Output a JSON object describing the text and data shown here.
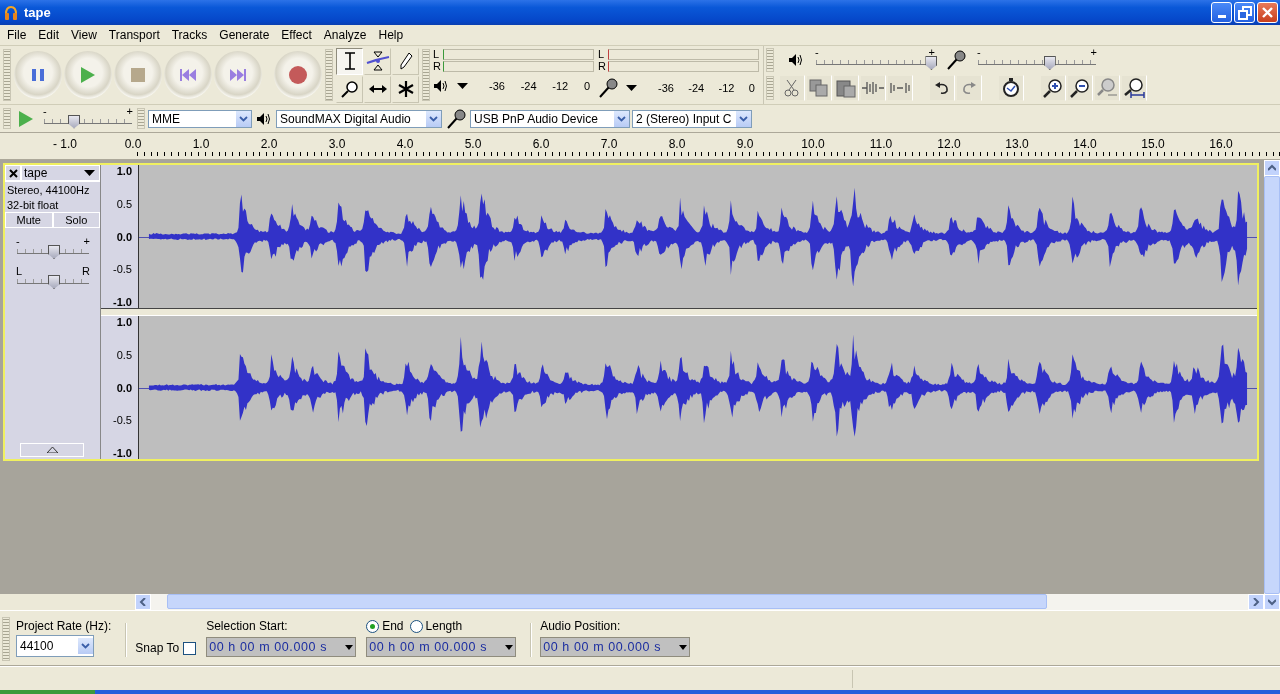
{
  "window": {
    "title": "tape"
  },
  "menu": [
    "File",
    "Edit",
    "View",
    "Transport",
    "Tracks",
    "Generate",
    "Effect",
    "Analyze",
    "Help"
  ],
  "transport": [
    {
      "kind": "pause"
    },
    {
      "kind": "play"
    },
    {
      "kind": "stop"
    },
    {
      "kind": "start"
    },
    {
      "kind": "end"
    },
    {
      "kind": "record"
    }
  ],
  "tools": [
    {
      "kind": "select",
      "selected": true
    },
    {
      "kind": "envelope",
      "selected": false
    },
    {
      "kind": "draw",
      "selected": false
    },
    {
      "kind": "zoom",
      "selected": false
    },
    {
      "kind": "timeshift",
      "selected": false
    },
    {
      "kind": "multi",
      "selected": false
    }
  ],
  "meters": [
    {
      "kind": "playback",
      "channels": [
        "L",
        "R"
      ],
      "ticks": [
        "-36",
        "-24",
        "-12",
        "0"
      ]
    },
    {
      "kind": "record",
      "channels": [
        "L",
        "R"
      ],
      "ticks": [
        "-36",
        "-24",
        "-12",
        "0"
      ]
    }
  ],
  "mixer": [
    {
      "kind": "playback",
      "min": "-",
      "max": "+",
      "level": 0.97
    },
    {
      "kind": "record",
      "min": "-",
      "max": "+",
      "level": 0.6
    }
  ],
  "edit_tools": [
    {
      "kind": "cut"
    },
    {
      "kind": "copy"
    },
    {
      "kind": "paste"
    },
    {
      "kind": "trim"
    },
    {
      "kind": "silence"
    },
    {
      "kind": "undo"
    },
    {
      "kind": "redo"
    },
    {
      "kind": "sync"
    },
    {
      "kind": "zoomin"
    },
    {
      "kind": "zoomout"
    },
    {
      "kind": "fitsel"
    },
    {
      "kind": "fit"
    }
  ],
  "play_at_speed": {
    "min": "-",
    "max": "+",
    "level": 0.33
  },
  "devices": {
    "host": "MME",
    "output": "SoundMAX Digital Audio",
    "input": "USB PnP Audio Device",
    "channels": "2 (Stereo) Input C"
  },
  "ruler": {
    "ticks": [
      "- 1.0",
      "0.0",
      "1.0",
      "2.0",
      "3.0",
      "4.0",
      "5.0",
      "6.0",
      "7.0",
      "8.0",
      "9.0",
      "10.0",
      "11.0",
      "12.0",
      "13.0",
      "14.0",
      "15.0",
      "16.0"
    ]
  },
  "track": {
    "name": "tape",
    "rate": "Stereo, 44100Hz",
    "format": "32-bit float",
    "mute": "Mute",
    "solo": "Solo",
    "gain": {
      "min": "-",
      "max": "+",
      "level": 0.5
    },
    "pan": {
      "min": "L",
      "max": "R",
      "level": 0.5
    },
    "channels": [
      {
        "scale": [
          "1.0",
          "0.5",
          "0.0",
          "-0.5",
          "-1.0"
        ]
      },
      {
        "scale": [
          "1.0",
          "0.5",
          "0.0",
          "-0.5",
          "-1.0"
        ]
      }
    ]
  },
  "selection_bar": {
    "rate_label": "Project Rate (Hz):",
    "rate": "44100",
    "snap_label": "Snap To",
    "snap_checked": false,
    "start_label": "Selection Start:",
    "start": "00 h 00 m 00.000 s",
    "modes": [
      {
        "label": "End",
        "selected": true
      },
      {
        "label": "Length",
        "selected": false
      }
    ],
    "end": "00 h 00 m 00.000 s",
    "position_label": "Audio Position:",
    "position": "00 h 00 m 00.000 s"
  }
}
